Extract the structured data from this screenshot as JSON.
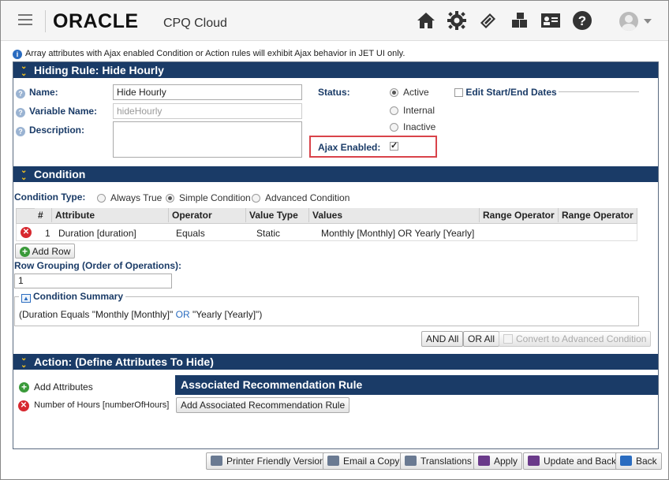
{
  "header": {
    "logo_text": "ORACLE",
    "product": "CPQ Cloud",
    "icons": [
      "menu-icon",
      "home-icon",
      "gear-icon",
      "tools-icon",
      "modules-icon",
      "contact-card-icon",
      "help-icon",
      "user-avatar-icon"
    ]
  },
  "info_message": "Array attributes with Ajax enabled Condition or Action rules will exhibit Ajax behavior in JET UI only.",
  "hiding_rule": {
    "title": "Hiding Rule: Hide Hourly",
    "name_label": "Name:",
    "name_value": "Hide Hourly",
    "variable_label": "Variable Name:",
    "variable_value": "hideHourly",
    "description_label": "Description:",
    "description_value": "",
    "status_label": "Status:",
    "status_options": [
      "Active",
      "Internal",
      "Inactive"
    ],
    "status_selected": "Active",
    "edit_dates_label": "Edit Start/End Dates",
    "ajax_label": "Ajax Enabled:",
    "ajax_checked": true
  },
  "condition": {
    "title": "Condition",
    "type_label": "Condition Type:",
    "type_options": [
      "Always True",
      "Simple Condition",
      "Advanced Condition"
    ],
    "type_selected": "Simple Condition",
    "columns": [
      "#",
      "Attribute",
      "Operator",
      "Value Type",
      "Values",
      "Range Operator",
      "Range Operator"
    ],
    "rows": [
      {
        "num": "1",
        "attribute": "Duration [duration]",
        "operator": "Equals",
        "value_type": "Static",
        "values": "Monthly [Monthly] OR Yearly [Yearly]",
        "range1": "",
        "range2": ""
      }
    ],
    "add_row_label": "Add Row",
    "grouping_label": "Row Grouping (Order of Operations):",
    "grouping_value": "1",
    "summary_label": "Condition Summary",
    "summary_part1": "(Duration Equals \"Monthly [Monthly]\"",
    "summary_or": "OR",
    "summary_part2": "\"Yearly [Yearly]\")",
    "and_all_label": "AND All",
    "or_all_label": "OR All",
    "convert_label": "Convert to Advanced Condition"
  },
  "action": {
    "title": "Action: (Define Attributes To Hide)",
    "add_attributes_label": "Add Attributes",
    "attribute_item": "Number of Hours [numberOfHours]",
    "assoc_title": "Associated Recommendation Rule",
    "assoc_button": "Add Associated Recommendation Rule"
  },
  "footer_buttons": {
    "printer": "Printer Friendly Version",
    "email": "Email a Copy",
    "translations": "Translations",
    "apply": "Apply",
    "update_back": "Update and Back",
    "back": "Back"
  },
  "colors": {
    "section_header": "#1a3b67",
    "label_blue": "#1a3b67",
    "highlight_red": "#d9434a",
    "link_blue": "#2a6cc0"
  }
}
